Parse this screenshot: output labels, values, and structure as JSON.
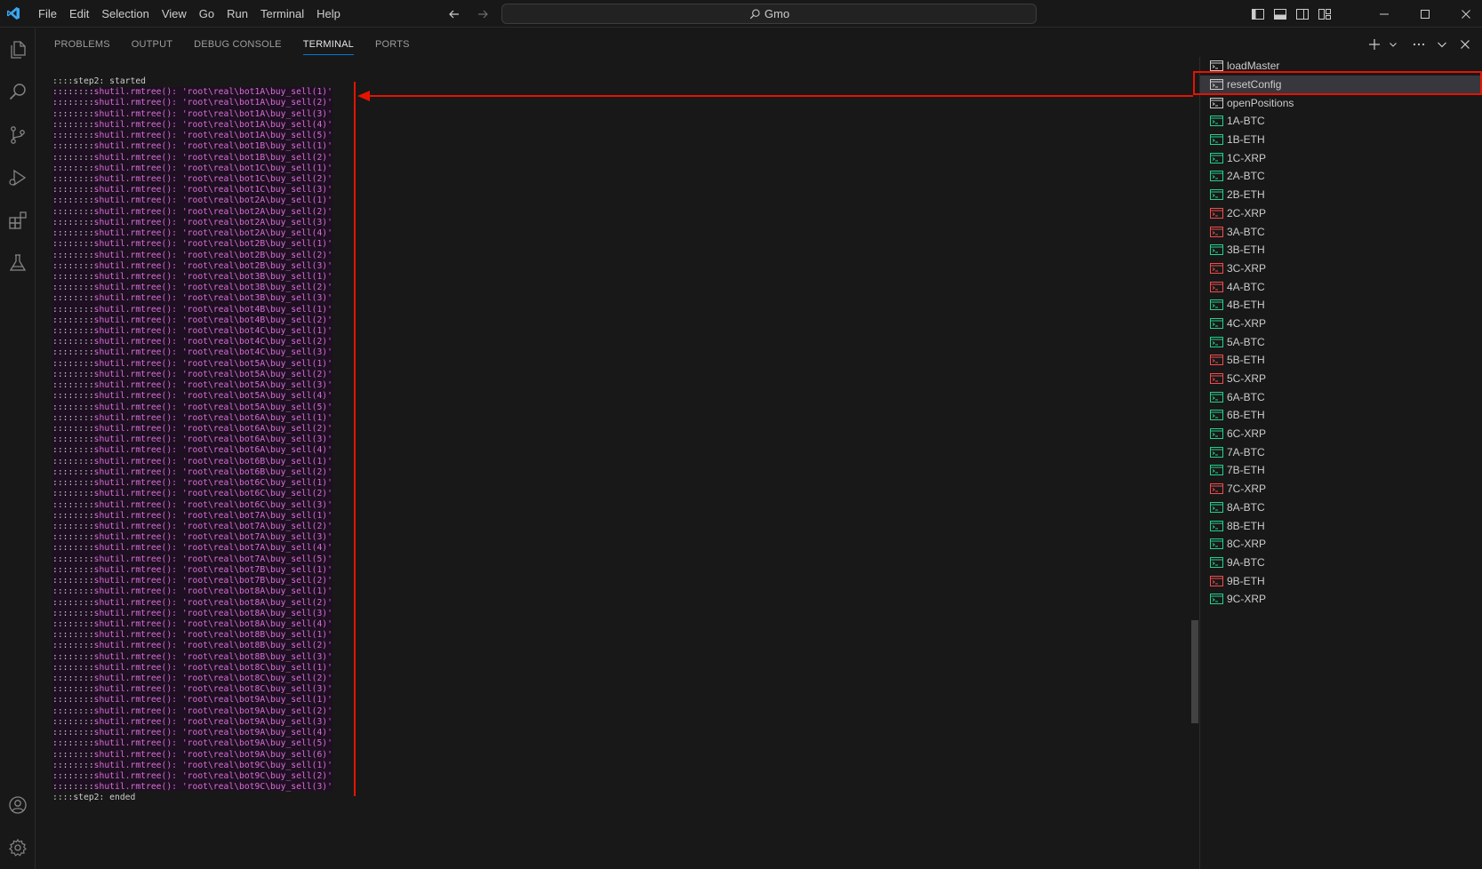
{
  "menu": [
    "File",
    "Edit",
    "Selection",
    "View",
    "Go",
    "Run",
    "Terminal",
    "Help"
  ],
  "search": {
    "text": "Gmo"
  },
  "colors": {
    "accent": "#0078d4",
    "red": "#e51400",
    "green": "#23d18b",
    "failRed": "#f14c4c",
    "magenta": "#d670d6"
  },
  "panel": {
    "tabs": [
      "PROBLEMS",
      "OUTPUT",
      "DEBUG CONSOLE",
      "TERMINAL",
      "PORTS"
    ],
    "active": 3
  },
  "terminal": {
    "start": "::::step2: started",
    "end": "::::step2: ended",
    "prefix": "::::::::",
    "call": "shutil.rmtree(): ",
    "paths": [
      "'root\\real\\bot1A\\buy_sell(1)'",
      "'root\\real\\bot1A\\buy_sell(2)'",
      "'root\\real\\bot1A\\buy_sell(3)'",
      "'root\\real\\bot1A\\buy_sell(4)'",
      "'root\\real\\bot1A\\buy_sell(5)'",
      "'root\\real\\bot1B\\buy_sell(1)'",
      "'root\\real\\bot1B\\buy_sell(2)'",
      "'root\\real\\bot1C\\buy_sell(1)'",
      "'root\\real\\bot1C\\buy_sell(2)'",
      "'root\\real\\bot1C\\buy_sell(3)'",
      "'root\\real\\bot2A\\buy_sell(1)'",
      "'root\\real\\bot2A\\buy_sell(2)'",
      "'root\\real\\bot2A\\buy_sell(3)'",
      "'root\\real\\bot2A\\buy_sell(4)'",
      "'root\\real\\bot2B\\buy_sell(1)'",
      "'root\\real\\bot2B\\buy_sell(2)'",
      "'root\\real\\bot2B\\buy_sell(3)'",
      "'root\\real\\bot3B\\buy_sell(1)'",
      "'root\\real\\bot3B\\buy_sell(2)'",
      "'root\\real\\bot3B\\buy_sell(3)'",
      "'root\\real\\bot4B\\buy_sell(1)'",
      "'root\\real\\bot4B\\buy_sell(2)'",
      "'root\\real\\bot4C\\buy_sell(1)'",
      "'root\\real\\bot4C\\buy_sell(2)'",
      "'root\\real\\bot4C\\buy_sell(3)'",
      "'root\\real\\bot5A\\buy_sell(1)'",
      "'root\\real\\bot5A\\buy_sell(2)'",
      "'root\\real\\bot5A\\buy_sell(3)'",
      "'root\\real\\bot5A\\buy_sell(4)'",
      "'root\\real\\bot5A\\buy_sell(5)'",
      "'root\\real\\bot6A\\buy_sell(1)'",
      "'root\\real\\bot6A\\buy_sell(2)'",
      "'root\\real\\bot6A\\buy_sell(3)'",
      "'root\\real\\bot6A\\buy_sell(4)'",
      "'root\\real\\bot6B\\buy_sell(1)'",
      "'root\\real\\bot6B\\buy_sell(2)'",
      "'root\\real\\bot6C\\buy_sell(1)'",
      "'root\\real\\bot6C\\buy_sell(2)'",
      "'root\\real\\bot6C\\buy_sell(3)'",
      "'root\\real\\bot7A\\buy_sell(1)'",
      "'root\\real\\bot7A\\buy_sell(2)'",
      "'root\\real\\bot7A\\buy_sell(3)'",
      "'root\\real\\bot7A\\buy_sell(4)'",
      "'root\\real\\bot7A\\buy_sell(5)'",
      "'root\\real\\bot7B\\buy_sell(1)'",
      "'root\\real\\bot7B\\buy_sell(2)'",
      "'root\\real\\bot8A\\buy_sell(1)'",
      "'root\\real\\bot8A\\buy_sell(2)'",
      "'root\\real\\bot8A\\buy_sell(3)'",
      "'root\\real\\bot8A\\buy_sell(4)'",
      "'root\\real\\bot8B\\buy_sell(1)'",
      "'root\\real\\bot8B\\buy_sell(2)'",
      "'root\\real\\bot8B\\buy_sell(3)'",
      "'root\\real\\bot8C\\buy_sell(1)'",
      "'root\\real\\bot8C\\buy_sell(2)'",
      "'root\\real\\bot8C\\buy_sell(3)'",
      "'root\\real\\bot9A\\buy_sell(1)'",
      "'root\\real\\bot9A\\buy_sell(2)'",
      "'root\\real\\bot9A\\buy_sell(3)'",
      "'root\\real\\bot9A\\buy_sell(4)'",
      "'root\\real\\bot9A\\buy_sell(5)'",
      "'root\\real\\bot9A\\buy_sell(6)'",
      "'root\\real\\bot9C\\buy_sell(1)'",
      "'root\\real\\bot9C\\buy_sell(2)'",
      "'root\\real\\bot9C\\buy_sell(3)'"
    ]
  },
  "terminal_tabs": [
    {
      "name": "loadMaster",
      "status": "neutral"
    },
    {
      "name": "resetConfig",
      "status": "neutral",
      "selected": true
    },
    {
      "name": "openPositions",
      "status": "neutral"
    },
    {
      "name": "1A-BTC",
      "status": "ok"
    },
    {
      "name": "1B-ETH",
      "status": "ok"
    },
    {
      "name": "1C-XRP",
      "status": "ok"
    },
    {
      "name": "2A-BTC",
      "status": "ok"
    },
    {
      "name": "2B-ETH",
      "status": "ok"
    },
    {
      "name": "2C-XRP",
      "status": "fail"
    },
    {
      "name": "3A-BTC",
      "status": "fail"
    },
    {
      "name": "3B-ETH",
      "status": "ok"
    },
    {
      "name": "3C-XRP",
      "status": "fail"
    },
    {
      "name": "4A-BTC",
      "status": "fail"
    },
    {
      "name": "4B-ETH",
      "status": "ok"
    },
    {
      "name": "4C-XRP",
      "status": "ok"
    },
    {
      "name": "5A-BTC",
      "status": "ok"
    },
    {
      "name": "5B-ETH",
      "status": "fail"
    },
    {
      "name": "5C-XRP",
      "status": "fail"
    },
    {
      "name": "6A-BTC",
      "status": "ok"
    },
    {
      "name": "6B-ETH",
      "status": "ok"
    },
    {
      "name": "6C-XRP",
      "status": "ok"
    },
    {
      "name": "7A-BTC",
      "status": "ok"
    },
    {
      "name": "7B-ETH",
      "status": "ok"
    },
    {
      "name": "7C-XRP",
      "status": "fail"
    },
    {
      "name": "8A-BTC",
      "status": "ok"
    },
    {
      "name": "8B-ETH",
      "status": "ok"
    },
    {
      "name": "8C-XRP",
      "status": "ok"
    },
    {
      "name": "9A-BTC",
      "status": "ok"
    },
    {
      "name": "9B-ETH",
      "status": "fail"
    },
    {
      "name": "9C-XRP",
      "status": "ok"
    }
  ]
}
